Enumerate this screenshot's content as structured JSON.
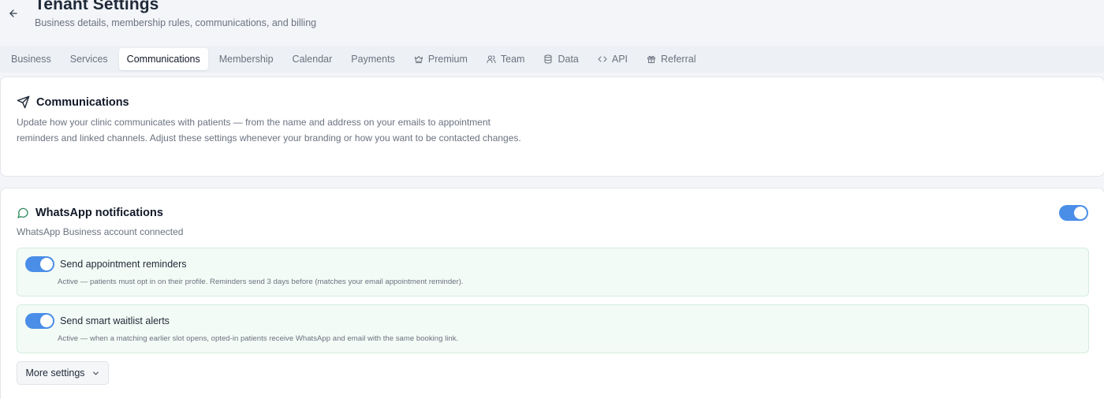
{
  "header": {
    "title": "Tenant Settings",
    "subtitle": "Business details, membership rules, communications, and billing"
  },
  "tabs": [
    {
      "label": "Business",
      "icon": null,
      "active": false
    },
    {
      "label": "Services",
      "icon": null,
      "active": false
    },
    {
      "label": "Communications",
      "icon": null,
      "active": true
    },
    {
      "label": "Membership",
      "icon": null,
      "active": false
    },
    {
      "label": "Calendar",
      "icon": null,
      "active": false
    },
    {
      "label": "Payments",
      "icon": null,
      "active": false
    },
    {
      "label": "Premium",
      "icon": "crown-icon",
      "active": false
    },
    {
      "label": "Team",
      "icon": "users-icon",
      "active": false
    },
    {
      "label": "Data",
      "icon": "database-icon",
      "active": false
    },
    {
      "label": "API",
      "icon": "code-icon",
      "active": false
    },
    {
      "label": "Referral",
      "icon": "gift-icon",
      "active": false
    }
  ],
  "communications": {
    "title": "Communications",
    "description": "Update how your clinic communicates with patients — from the name and address on your emails to appointment reminders and linked channels. Adjust these settings whenever your branding or how you want to be contacted changes."
  },
  "whatsapp": {
    "title": "WhatsApp notifications",
    "subtitle": "WhatsApp Business account connected",
    "enabled": true,
    "options": [
      {
        "title": "Send appointment reminders",
        "description": "Active — patients must opt in on their profile. Reminders send 3 days before (matches your email appointment reminder).",
        "enabled": true
      },
      {
        "title": "Send smart waitlist alerts",
        "description": "Active — when a matching earlier slot opens, opted-in patients receive WhatsApp and email with the same booking link.",
        "enabled": true
      }
    ],
    "more_settings_label": "More settings"
  },
  "colors": {
    "accent": "#4a8ee8",
    "whatsapp_icon": "#2f8a5c",
    "option_bg": "#f3fbf6"
  }
}
